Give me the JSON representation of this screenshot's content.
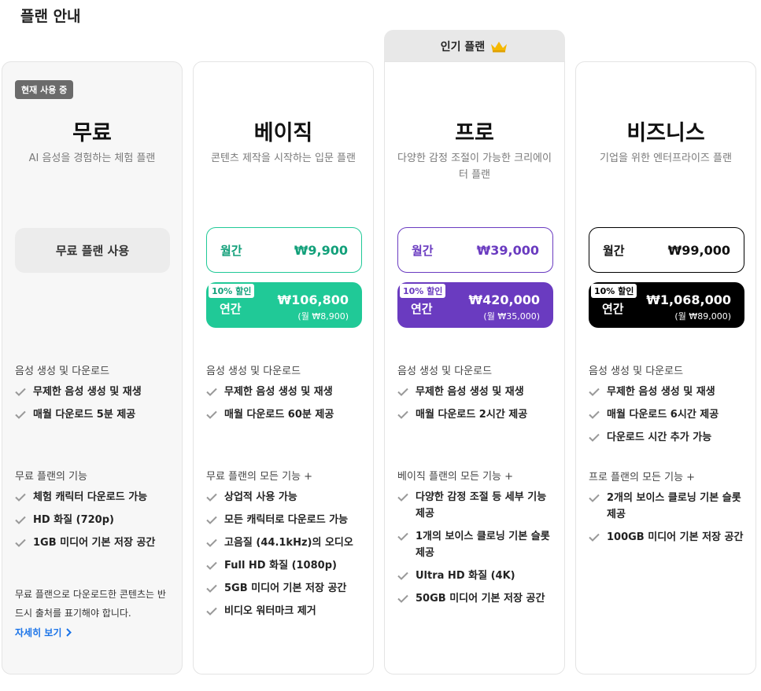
{
  "page_title": "플랜 안내",
  "colors": {
    "basic": "#20c997",
    "pro": "#6a3bc0",
    "business": "#000000"
  },
  "plans": {
    "free": {
      "current_badge": "현재 사용 중",
      "name": "무료",
      "desc": "AI 음성을 경험하는 체험 플랜",
      "button": "무료 플랜 사용",
      "section1_title": "음성 생성 및 다운로드",
      "section1_items": [
        "무제한 음성 생성 및 재생",
        "매월 다운로드 5분 제공"
      ],
      "section2_title": "무료 플랜의 기능",
      "section2_items": [
        "체험 캐릭터 다운로드 가능",
        "HD 화질 (720p)",
        "1GB 미디어 기본 저장 공간"
      ],
      "note": "무료 플랜으로 다운로드한 콘텐츠는 반드시 출처를 표기해야 합니다.",
      "more_link": "자세히 보기"
    },
    "basic": {
      "name": "베이직",
      "desc": "콘텐츠 제작을 시작하는 입문 플랜",
      "monthly_label": "월간",
      "monthly_price": "₩9,900",
      "discount": "10% 할인",
      "yearly_label": "연간",
      "yearly_price": "₩106,800",
      "yearly_sub": "(월 ₩8,900)",
      "section1_title": "음성 생성 및 다운로드",
      "section1_items": [
        "무제한 음성 생성 및 재생",
        "매월 다운로드 60분 제공"
      ],
      "section2_title": "무료 플랜의 모든 기능 +",
      "section2_items": [
        "상업적 사용 가능",
        "모든 캐릭터로 다운로드 가능",
        "고음질 (44.1kHz)의 오디오",
        "Full HD 화질 (1080p)",
        "5GB 미디어 기본 저장 공간",
        "비디오 워터마크 제거"
      ]
    },
    "pro": {
      "popular_label": "인기 플랜",
      "name": "프로",
      "desc": "다양한 감정 조절이 가능한 크리에이터 플랜",
      "monthly_label": "월간",
      "monthly_price": "₩39,000",
      "discount": "10% 할인",
      "yearly_label": "연간",
      "yearly_price": "₩420,000",
      "yearly_sub": "(월 ₩35,000)",
      "section1_title": "음성 생성 및 다운로드",
      "section1_items": [
        "무제한 음성 생성 및 재생",
        "매월 다운로드 2시간 제공"
      ],
      "section2_title": "베이직 플랜의 모든 기능 +",
      "section2_items": [
        "다양한 감정 조절 등 세부 기능 제공",
        "1개의 보이스 클로닝 기본 슬롯 제공",
        "Ultra HD 화질 (4K)",
        "50GB 미디어 기본 저장 공간"
      ]
    },
    "business": {
      "name": "비즈니스",
      "desc": "기업을 위한 엔터프라이즈 플랜",
      "monthly_label": "월간",
      "monthly_price": "₩99,000",
      "discount": "10% 할인",
      "yearly_label": "연간",
      "yearly_price": "₩1,068,000",
      "yearly_sub": "(월 ₩89,000)",
      "section1_title": "음성 생성 및 다운로드",
      "section1_items": [
        "무제한 음성 생성 및 재생",
        "매월 다운로드 6시간 제공",
        "다운로드 시간 추가 가능"
      ],
      "section2_title": "프로 플랜의 모든 기능 +",
      "section2_items": [
        "2개의 보이스 클로닝 기본 슬롯 제공",
        "100GB 미디어 기본 저장 공간"
      ]
    }
  }
}
